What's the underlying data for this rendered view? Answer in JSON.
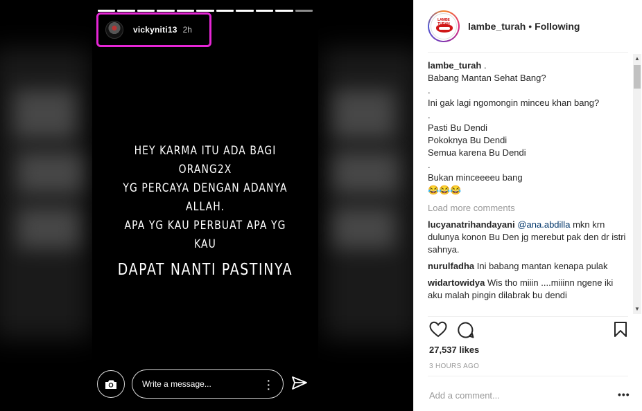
{
  "story": {
    "username": "vickyniti13",
    "time": "2h",
    "text_lines": [
      "HEY KARMA ITU ADA BAGI ORANG2X",
      "YG PERCAYA DENGAN ADANYA ALLAH.",
      "APA YG KAU PERBUAT APA YG KAU"
    ],
    "text_big": "DAPAT NANTI PASTINYA",
    "message_placeholder": "Write a message...",
    "progress_segments": 11
  },
  "post": {
    "account": "lambe_turah",
    "separator": "•",
    "follow_status": "Following",
    "logo_text": "LAMBE TURAH",
    "caption_user": "lambe_turah",
    "caption_lines": [
      ".",
      "Babang Mantan Sehat Bang?",
      ".",
      "Ini gak lagi ngomongin minceu khan bang?",
      ".",
      "Pasti Bu Dendi",
      "Pokoknya Bu Dendi",
      "Semua karena Bu Dendi",
      ".",
      "Bukan minceeeeu bang",
      "😂😂😂"
    ],
    "load_more": "Load more comments",
    "comments": [
      {
        "user": "lucyanatrihandayani",
        "mention": "@ana.abdilla",
        "text": "mkn krn dulunya konon Bu Den jg merebut pak den dr istri sahnya."
      },
      {
        "user": "nurulfadha",
        "mention": "",
        "text": "Ini babang mantan kenapa pulak"
      },
      {
        "user": "widartowidya",
        "mention": "",
        "text": "Wis tho miiin ....miiinn ngene iki aku malah pingin dilabrak bu dendi"
      }
    ],
    "likes": "27,537 likes",
    "time_ago": "3 HOURS AGO",
    "add_comment_placeholder": "Add a comment...",
    "more_options": "•••"
  },
  "colors": {
    "story_highlight": "#e626d6",
    "mention": "#003569",
    "muted": "#999999"
  }
}
